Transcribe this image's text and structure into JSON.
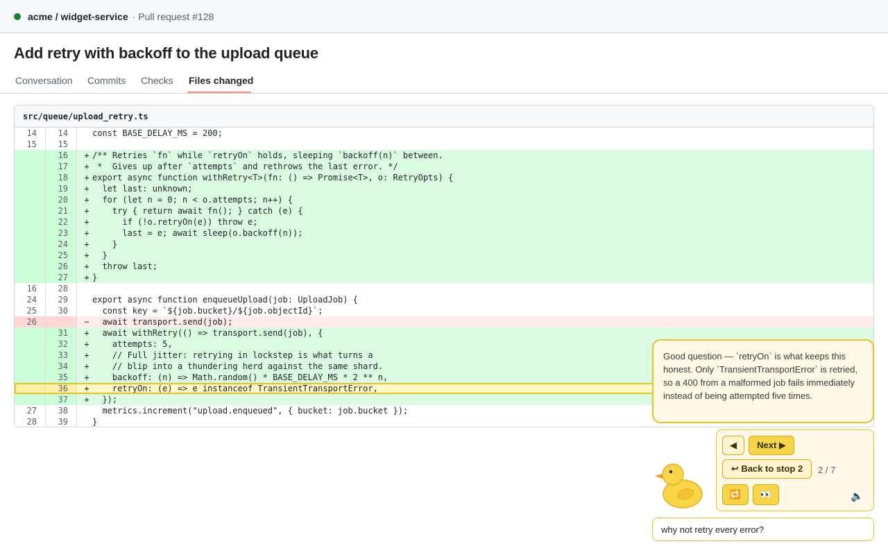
{
  "header": {
    "repo": "acme / widget-service",
    "pr_ref": "· Pull request #128",
    "status_color": "#1a7f37"
  },
  "pr": {
    "title": "Add retry with backoff to the upload queue"
  },
  "tabs": [
    {
      "label": "Conversation",
      "active": false
    },
    {
      "label": "Commits",
      "active": false
    },
    {
      "label": "Checks",
      "active": false
    },
    {
      "label": "Files changed",
      "active": true
    }
  ],
  "file": {
    "path": "src/queue/upload_retry.ts"
  },
  "diff_lines": [
    {
      "old": "14",
      "new": "14",
      "type": "ctx",
      "sign": "",
      "code": "const BASE_DELAY_MS = 200;"
    },
    {
      "old": "15",
      "new": "15",
      "type": "ctx",
      "sign": "",
      "code": ""
    },
    {
      "old": "",
      "new": "16",
      "type": "add",
      "sign": "+",
      "code": "/** Retries `fn` while `retryOn` holds, sleeping `backoff(n)` between."
    },
    {
      "old": "",
      "new": "17",
      "type": "add",
      "sign": "+",
      "code": " *  Gives up after `attempts` and rethrows the last error. */"
    },
    {
      "old": "",
      "new": "18",
      "type": "add",
      "sign": "+",
      "code": "export async function withRetry<T>(fn: () => Promise<T>, o: RetryOpts) {"
    },
    {
      "old": "",
      "new": "19",
      "type": "add",
      "sign": "+",
      "code": "  let last: unknown;"
    },
    {
      "old": "",
      "new": "20",
      "type": "add",
      "sign": "+",
      "code": "  for (let n = 0; n < o.attempts; n++) {"
    },
    {
      "old": "",
      "new": "21",
      "type": "add",
      "sign": "+",
      "code": "    try { return await fn(); } catch (e) {"
    },
    {
      "old": "",
      "new": "22",
      "type": "add",
      "sign": "+",
      "code": "      if (!o.retryOn(e)) throw e;"
    },
    {
      "old": "",
      "new": "23",
      "type": "add",
      "sign": "+",
      "code": "      last = e; await sleep(o.backoff(n));"
    },
    {
      "old": "",
      "new": "24",
      "type": "add",
      "sign": "+",
      "code": "    }"
    },
    {
      "old": "",
      "new": "25",
      "type": "add",
      "sign": "+",
      "code": "  }"
    },
    {
      "old": "",
      "new": "26",
      "type": "add",
      "sign": "+",
      "code": "  throw last;"
    },
    {
      "old": "",
      "new": "27",
      "type": "add",
      "sign": "+",
      "code": "}"
    },
    {
      "old": "16",
      "new": "28",
      "type": "ctx",
      "sign": "",
      "code": ""
    },
    {
      "old": "24",
      "new": "29",
      "type": "ctx",
      "sign": "",
      "code": "export async function enqueueUpload(job: UploadJob) {"
    },
    {
      "old": "25",
      "new": "30",
      "type": "ctx",
      "sign": "",
      "code": "  const key = `${job.bucket}/${job.objectId}`;"
    },
    {
      "old": "26",
      "new": "",
      "type": "del",
      "sign": "−",
      "code": "  await transport.send(job);"
    },
    {
      "old": "",
      "new": "31",
      "type": "add",
      "sign": "+",
      "code": "  await withRetry(() => transport.send(job), {"
    },
    {
      "old": "",
      "new": "32",
      "type": "add",
      "sign": "+",
      "code": "    attempts: 5,"
    },
    {
      "old": "",
      "new": "33",
      "type": "add",
      "sign": "+",
      "code": "    // Full jitter: retrying in lockstep is what turns a"
    },
    {
      "old": "",
      "new": "34",
      "type": "add",
      "sign": "+",
      "code": "    // blip into a thundering herd against the same shard."
    },
    {
      "old": "",
      "new": "35",
      "type": "add",
      "sign": "+",
      "code": "    backoff: (n) => Math.random() * BASE_DELAY_MS * 2 ** n,"
    },
    {
      "old": "",
      "new": "36",
      "type": "hl",
      "sign": "+",
      "code": "    retryOn: (e) => e instanceof TransientTransportError,"
    },
    {
      "old": "",
      "new": "37",
      "type": "add",
      "sign": "+",
      "code": "  });"
    },
    {
      "old": "27",
      "new": "38",
      "type": "ctx",
      "sign": "",
      "code": "  metrics.increment(\"upload.enqueued\", { bucket: job.bucket });"
    },
    {
      "old": "28",
      "new": "39",
      "type": "ctx",
      "sign": "",
      "code": "}"
    }
  ],
  "assistant": {
    "message": "Good question — `retryOn` is what keeps this honest. Only `TransientTransportError` is retried, so a 400 from a malformed job fails immediately instead of being attempted five times.",
    "prev_label": "◀",
    "next_label": "Next ▶",
    "back_label": "↩ Back to stop 2",
    "counter": "2 / 7",
    "replay_icon": "🔁",
    "look_icon": "👀",
    "speaker_icon": "🔈",
    "input_value": "why not retry every error?",
    "accent_color": "#e6c229"
  }
}
